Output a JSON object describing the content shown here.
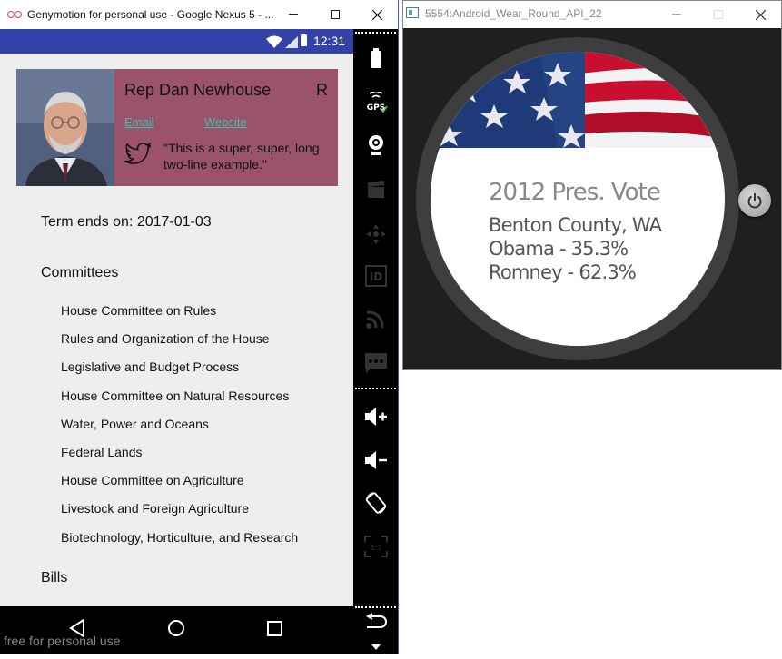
{
  "genymotion": {
    "window_title": "Genymotion for personal use - Google Nexus 5 - ...",
    "status_time": "12:31",
    "rep_card": {
      "name": "Rep Dan Newhouse",
      "party": "R",
      "email_label": "Email",
      "website_label": "Website",
      "tweet": "\"This is a super, super, long two-line example.\"",
      "bg_color": "#9a536a",
      "link_color": "#3ac2b0"
    },
    "term": "Term ends on: 2017-01-03",
    "committees_heading": "Committees",
    "committees": [
      "House Committee on Rules",
      "Rules and Organization of the House",
      "Legislative and Budget Process",
      "House Committee on Natural Resources",
      "Water, Power and Oceans",
      "Federal Lands",
      "House Committee on Agriculture",
      "Livestock and Foreign Agriculture",
      "Biotechnology, Horticulture, and Research"
    ],
    "bills_heading": "Bills",
    "watermark": "free for personal use",
    "status_bar_color": "#3442a8",
    "toolbar_icons": [
      "battery-icon",
      "gps-icon",
      "camera-icon",
      "video-icon",
      "dpad-icon",
      "id-icon",
      "cast-icon",
      "sms-icon",
      "volume-up-icon",
      "volume-down-icon",
      "rotate-icon",
      "pixel-perfect-icon",
      "back-icon",
      "scroll-down-icon"
    ]
  },
  "wear": {
    "window_title": "5554:Android_Wear_Round_API_22",
    "card_title": "2012 Pres. Vote",
    "county": "Benton County, WA",
    "obama": "Obama - 35.3%",
    "romney": "Romney - 62.3%"
  }
}
